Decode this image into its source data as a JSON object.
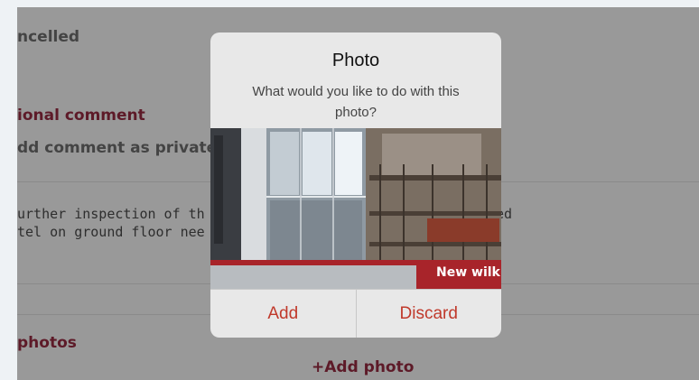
{
  "background": {
    "status": "ncelled",
    "comment_section": {
      "heading": "ional comment",
      "private_question": "dd comment as private?"
    },
    "comment_text": {
      "line1": "urther inspection of th",
      "line1_tail": "ed",
      "line2": "tel on ground floor nee"
    },
    "photos_section": {
      "heading": " photos",
      "add_photo_label": "+Add photo"
    }
  },
  "dialog": {
    "title": "Photo",
    "message": "What would you like to do with this photo?",
    "photo_sign_text": "New wilk",
    "add_label": "Add",
    "discard_label": "Discard"
  },
  "colors": {
    "accent_red": "#c0392b",
    "heading_maroon": "#5d1a28",
    "overlay_gray": "#999999"
  }
}
